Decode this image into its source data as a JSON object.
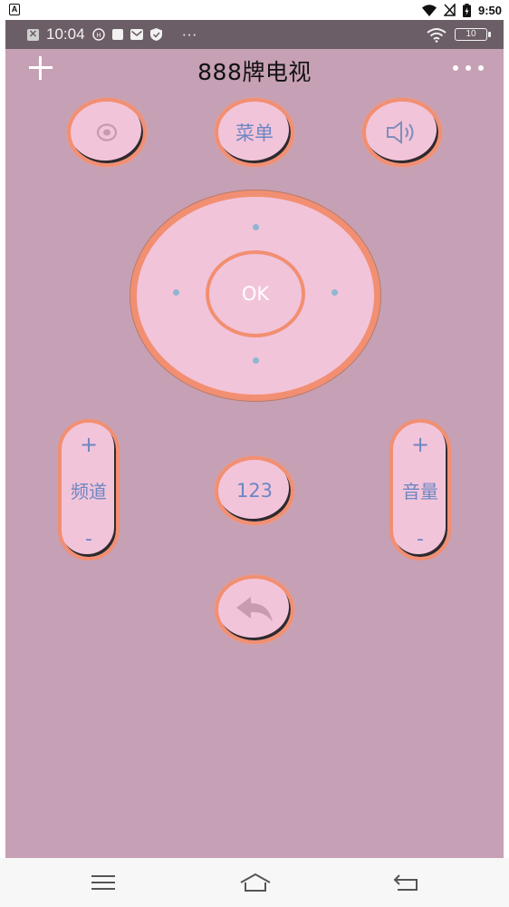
{
  "system_status": {
    "left_badge": "A",
    "time": "9:50"
  },
  "inner_status": {
    "time": "10:04",
    "more": "···",
    "battery": "10"
  },
  "header": {
    "title": "888牌电视"
  },
  "remote": {
    "menu_label": "菜单",
    "ok_label": "OK",
    "number_label": "123",
    "channel": {
      "plus": "+",
      "label": "频道",
      "minus": "-"
    },
    "volume": {
      "plus": "+",
      "label": "音量",
      "minus": "-"
    }
  },
  "colors": {
    "background": "#c6a0b4",
    "button_fill": "#f2c4da",
    "button_ring": "#f28f72",
    "button_text": "#6d86c2"
  },
  "icons": {
    "power": "power-icon",
    "mute": "speaker-icon",
    "back": "back-arrow-icon",
    "add": "plus-icon",
    "more": "more-dots-icon"
  }
}
